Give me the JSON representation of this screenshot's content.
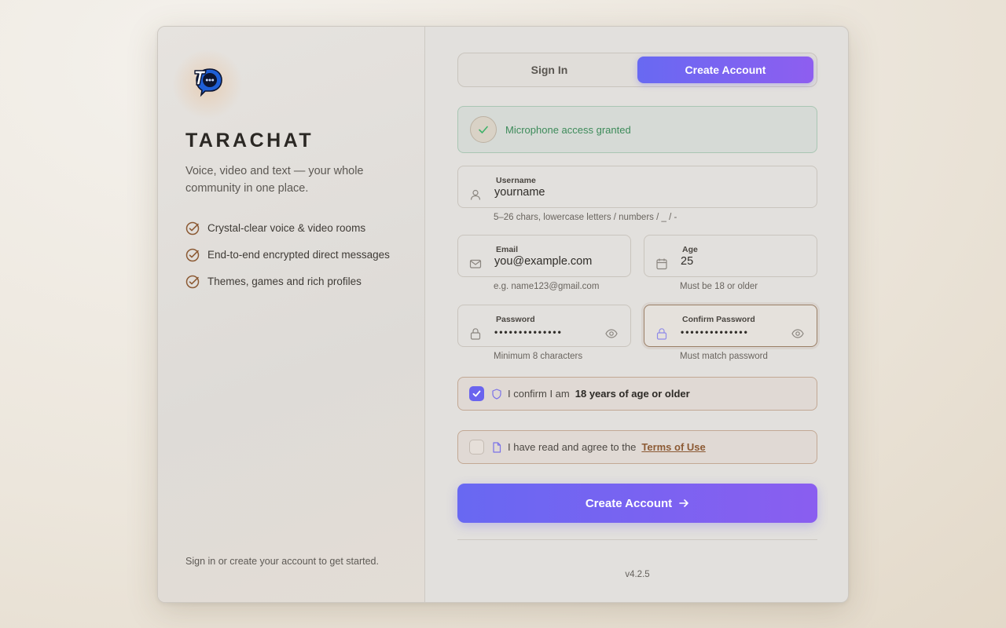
{
  "brand": {
    "name": "TARACHAT",
    "tagline": "Voice, video and text — your whole community in one place.",
    "logo_icon": "tarachat-chat-bubble-logo"
  },
  "features": [
    {
      "label": "Crystal-clear voice & video rooms",
      "icon": "check-circle-icon"
    },
    {
      "label": "End-to-end encrypted direct messages",
      "icon": "check-circle-icon"
    },
    {
      "label": "Themes, games and rich profiles",
      "icon": "check-circle-icon"
    }
  ],
  "left_footer": "Sign in or create your account to get started.",
  "tabs": {
    "signin": "Sign In",
    "create": "Create Account",
    "active": "create"
  },
  "mic_status": {
    "text": "Microphone access granted",
    "icon": "checkmark-icon",
    "color": "#3d8b5a"
  },
  "form": {
    "username": {
      "label": "Username",
      "value": "yourname",
      "hint": "5–26 chars, lowercase letters / numbers / _ / -",
      "icon": "user-icon"
    },
    "email": {
      "label": "Email",
      "value": "you@example.com",
      "hint": "e.g. name123@gmail.com",
      "icon": "mail-icon"
    },
    "age": {
      "label": "Age",
      "value": "25",
      "hint": "Must be 18 or older",
      "icon": "calendar-icon"
    },
    "password": {
      "label": "Password",
      "value": "••••••••••••••",
      "hint": "Minimum 8 characters",
      "icon": "lock-icon"
    },
    "confirm_password": {
      "label": "Confirm Password",
      "value": "••••••••••••••",
      "hint": "Must match password",
      "icon": "lock-icon"
    }
  },
  "age_confirm": {
    "checked": true,
    "prefix": "I confirm I am",
    "bold": "18 years of age or older",
    "icon": "shield-icon"
  },
  "terms": {
    "checked": false,
    "prefix": "I have read and agree to the",
    "link": "Terms of Use",
    "icon": "document-icon"
  },
  "submit": {
    "label": "Create Account",
    "icon": "arrow-right-icon"
  },
  "version": "v4.2.5",
  "colors": {
    "accent_start": "#6868f2",
    "accent_end": "#8a5ef0",
    "link": "#8c5a34",
    "feature_check": "#8c5a34"
  }
}
